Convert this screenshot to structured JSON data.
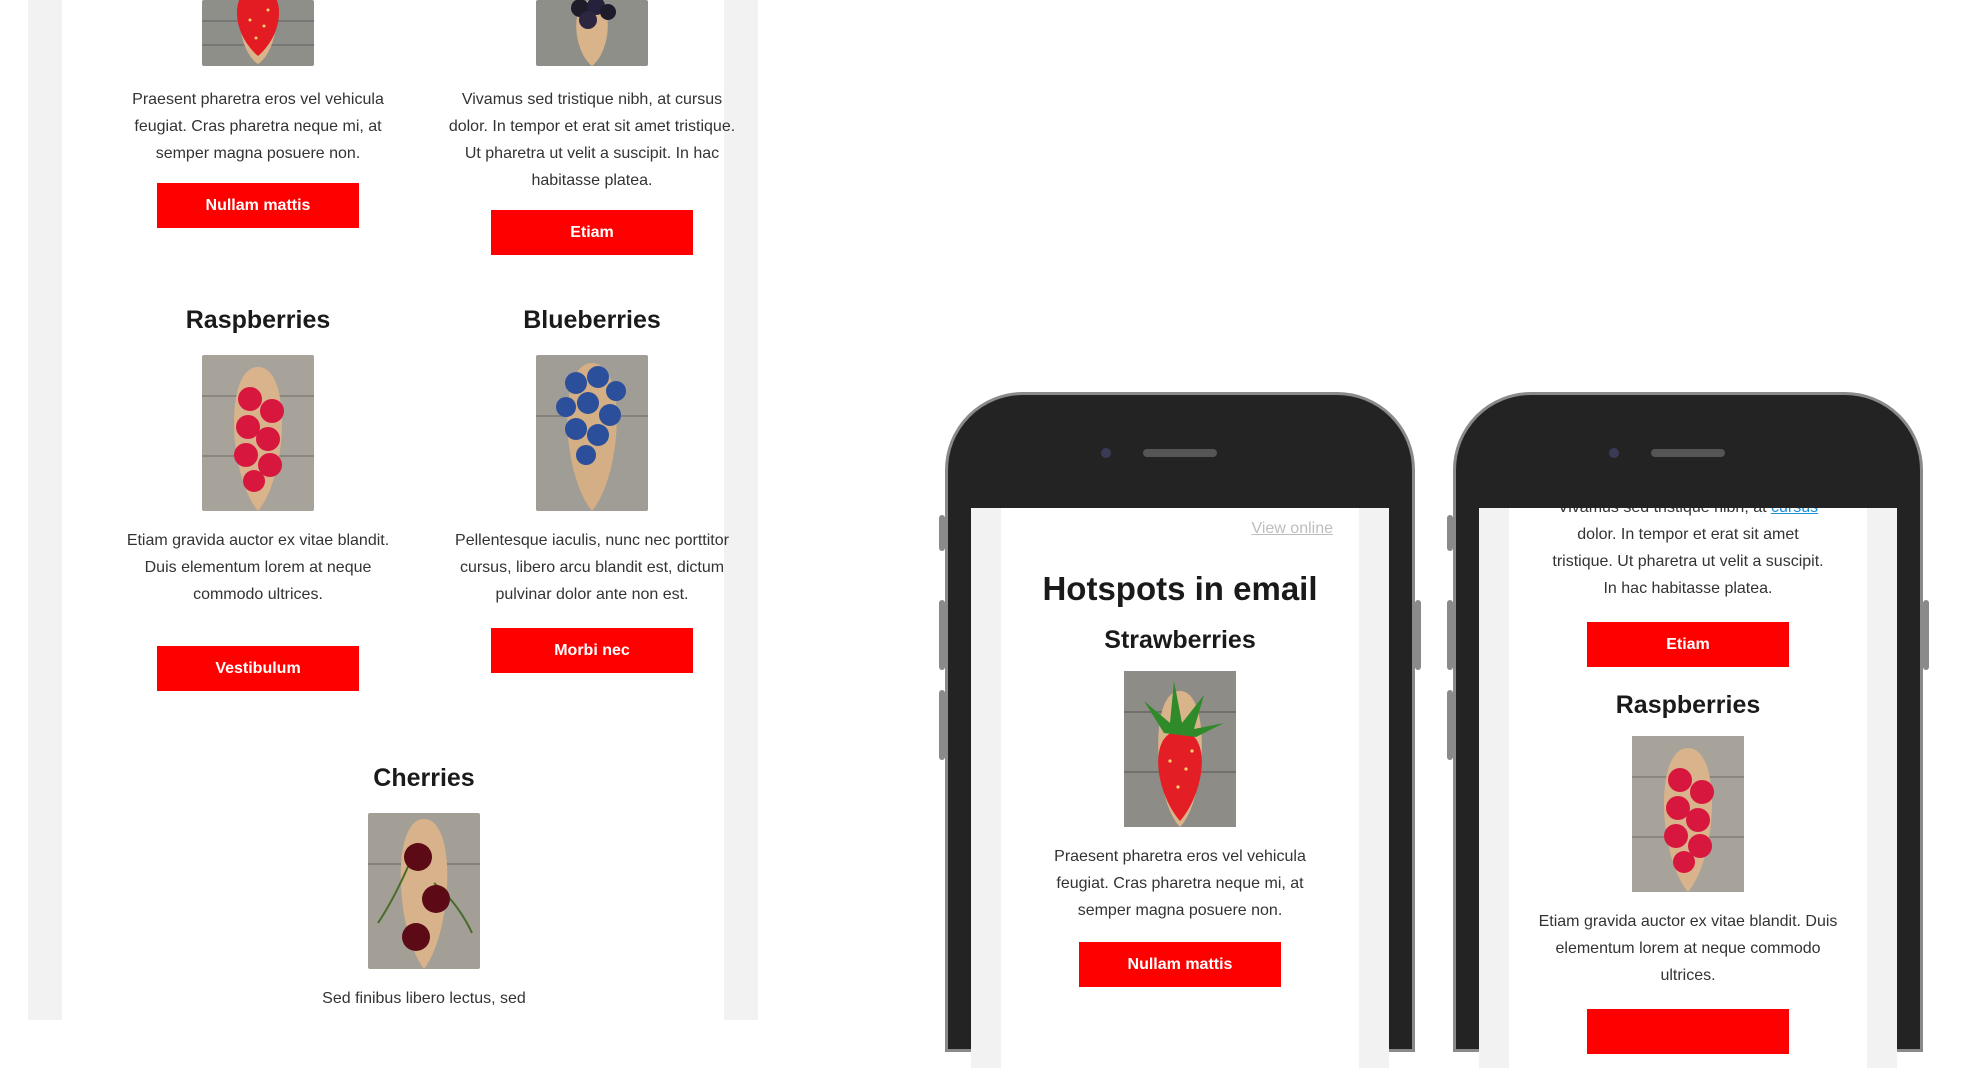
{
  "colors": {
    "accent": "#ff0000",
    "panel_bg": "#f2f2f2",
    "phone_body": "#232323",
    "link": "#1b8fd6"
  },
  "desktop": {
    "row1": {
      "left": {
        "image_icon": "strawberry-icon",
        "text": "Praesent pharetra eros vel vehicula feugiat. Cras pharetra neque mi, at semper magna posuere non.",
        "button": "Nullam mattis"
      },
      "right": {
        "image_icon": "blackberry-icon",
        "text": "Vivamus sed tristique nibh, at cursus dolor. In tempor et erat sit amet tristique. Ut pharetra ut velit a suscipit. In hac habitasse platea.",
        "button": "Etiam"
      }
    },
    "row2": {
      "left": {
        "title": "Raspberries",
        "image_icon": "raspberry-icon",
        "text": "Etiam gravida auctor ex vitae blandit. Duis elementum lorem at neque commodo ultrices.",
        "button": "Vestibulum"
      },
      "right": {
        "title": "Blueberries",
        "image_icon": "blueberry-icon",
        "text": "Pellentesque iaculis, nunc nec porttitor cursus, libero arcu blandit est, dictum pulvinar dolor ante non est.",
        "button": "Morbi nec"
      }
    },
    "row3": {
      "title": "Cherries",
      "image_icon": "cherry-icon",
      "text": "Sed finibus libero lectus, sed"
    }
  },
  "phone1": {
    "view_online": "View online",
    "heading": "Hotspots in email",
    "section_title": "Strawberries",
    "image_icon": "strawberry-icon",
    "text": "Praesent pharetra eros vel vehicula feugiat. Cras pharetra neque mi, at semper magna posuere non.",
    "button": "Nullam mattis"
  },
  "phone2": {
    "partial_top_text": "Vivamus sed tristique nibh, at",
    "partial_top_link": "cursus",
    "text_top": "dolor. In tempor et erat sit amet tristique. Ut pharetra ut velit a suscipit. In hac habitasse platea.",
    "button_top": "Etiam",
    "section_title": "Raspberries",
    "image_icon": "raspberry-icon",
    "text": "Etiam gravida auctor ex vitae blandit. Duis elementum lorem at neque commodo ultrices."
  }
}
